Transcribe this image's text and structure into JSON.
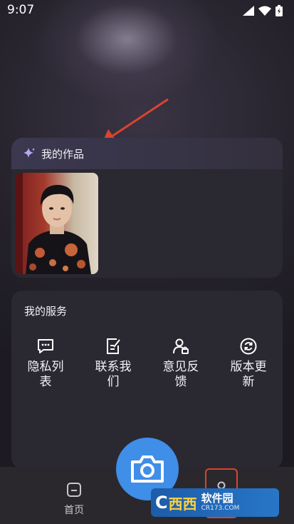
{
  "status_bar": {
    "time": "9:07"
  },
  "works": {
    "title": "我的作品",
    "items": [
      {
        "kind": "portrait"
      }
    ]
  },
  "services": {
    "title": "我的服务",
    "items": [
      {
        "label": "隐私列表",
        "icon": "chat-icon"
      },
      {
        "label": "联系我们",
        "icon": "edit-note-icon"
      },
      {
        "label": "意见反馈",
        "icon": "user-feedback-icon"
      },
      {
        "label": "版本更新",
        "icon": "refresh-icon"
      }
    ]
  },
  "tabbar": {
    "home_label": "首页"
  },
  "watermark": {
    "logo": "C",
    "brand_mark": "西西",
    "main": "软件园",
    "sub": "CR173.COM"
  },
  "colors": {
    "accent": "#3f8ee8",
    "highlight_box": "#d8452f",
    "arrow": "#d8452f"
  }
}
